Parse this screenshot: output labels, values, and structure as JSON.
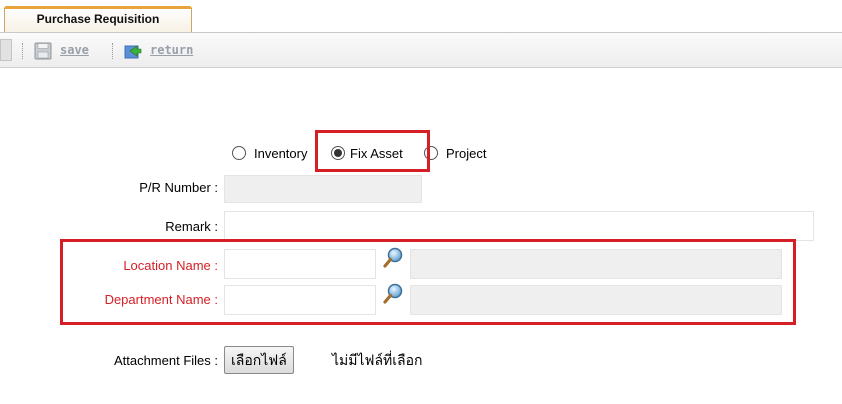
{
  "tab": {
    "title": "Purchase Requisition"
  },
  "toolbar": {
    "save_label": "save",
    "return_label": "return"
  },
  "asset_type": {
    "options": [
      {
        "label": "Inventory",
        "checked": false
      },
      {
        "label": "Fix Asset",
        "checked": true
      },
      {
        "label": "Project",
        "checked": false
      }
    ]
  },
  "form": {
    "pr_number": {
      "label": "P/R Number :",
      "value": ""
    },
    "remark": {
      "label": "Remark :",
      "value": ""
    },
    "location": {
      "label": "Location Name :",
      "code": "",
      "name": ""
    },
    "department": {
      "label": "Department Name :",
      "code": "",
      "name": ""
    },
    "attachment": {
      "label": "Attachment Files :",
      "button": "เลือกไฟล์",
      "status": "ไม่มีไฟล์ที่เลือก"
    }
  },
  "colors": {
    "required_label": "#d41f26",
    "highlight_border": "#d41f26",
    "tab_accent": "#e8a33a"
  }
}
